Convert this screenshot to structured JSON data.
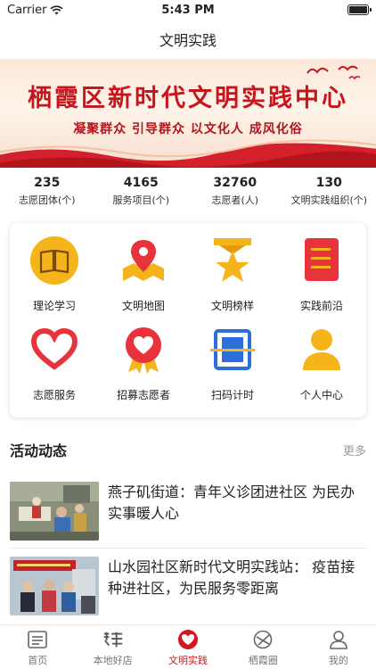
{
  "status": {
    "carrier": "Carrier",
    "time": "5:43 PM"
  },
  "nav": {
    "title": "文明实践"
  },
  "banner": {
    "title": "栖霞区新时代文明实践中心",
    "subtitle": "凝聚群众 引导群众 以文化人 成风化俗"
  },
  "stats": [
    {
      "value": "235",
      "label": "志愿团体(个)"
    },
    {
      "value": "4165",
      "label": "服务项目(个)"
    },
    {
      "value": "32760",
      "label": "志愿者(人)"
    },
    {
      "value": "130",
      "label": "文明实践组织(个)"
    }
  ],
  "grid": [
    {
      "label": "理论学习",
      "icon": "book-icon"
    },
    {
      "label": "文明地图",
      "icon": "map-pin-icon"
    },
    {
      "label": "文明榜样",
      "icon": "star-medal-icon"
    },
    {
      "label": "实践前沿",
      "icon": "document-icon"
    },
    {
      "label": "志愿服务",
      "icon": "heart-hand-icon"
    },
    {
      "label": "招募志愿者",
      "icon": "heart-badge-icon"
    },
    {
      "label": "扫码计时",
      "icon": "scan-icon"
    },
    {
      "label": "个人中心",
      "icon": "person-icon"
    }
  ],
  "section": {
    "title": "活动动态",
    "more": "更多"
  },
  "news": [
    {
      "title": "燕子矶街道：青年义诊团进社区 为民办实事暖人心"
    },
    {
      "title": "山水园社区新时代文明实践站： 疫苗接种进社区，为民服务零距离"
    }
  ],
  "tabs": [
    {
      "label": "首页",
      "icon": "home-icon"
    },
    {
      "label": "本地好店",
      "icon": "store-icon"
    },
    {
      "label": "文明实践",
      "icon": "heart-icon"
    },
    {
      "label": "栖霞圈",
      "icon": "circle-icon"
    },
    {
      "label": "我的",
      "icon": "profile-icon"
    }
  ],
  "colors": {
    "accent": "#d5141d",
    "icon_yellow": "#f6b41b",
    "icon_red": "#e8333c"
  }
}
